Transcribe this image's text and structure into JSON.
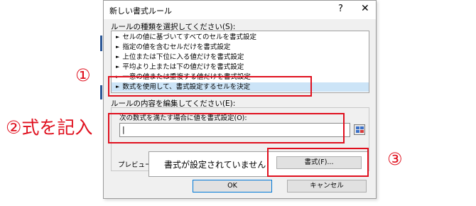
{
  "dialog": {
    "title": "新しい書式ルール",
    "help": "?",
    "close": "✕"
  },
  "rule_type": {
    "label": "ルールの種類を選択してください(S):",
    "items": [
      "セルの値に基づいてすべてのセルを書式設定",
      "指定の値を含むセルだけを書式設定",
      "上位または下位に入る値だけを書式設定",
      "平均より上または下の値だけを書式設定",
      "一意の値または重複する値だけを書式設定",
      "数式を使用して、書式設定するセルを決定"
    ],
    "selected_index": 5
  },
  "rule_edit": {
    "label": "ルールの内容を編集してください(E):",
    "formula_label": "次の数式を満たす場合に値を書式設定(O):",
    "formula_value": "|"
  },
  "preview": {
    "label": "プレビュー:",
    "text": "書式が設定されていません",
    "format_button": "書式(F)..."
  },
  "buttons": {
    "ok": "OK",
    "cancel": "キャンセル"
  },
  "annotations": {
    "step1": "①",
    "step2": "②式を記入",
    "step3": "③",
    "color": "#e0101e"
  }
}
